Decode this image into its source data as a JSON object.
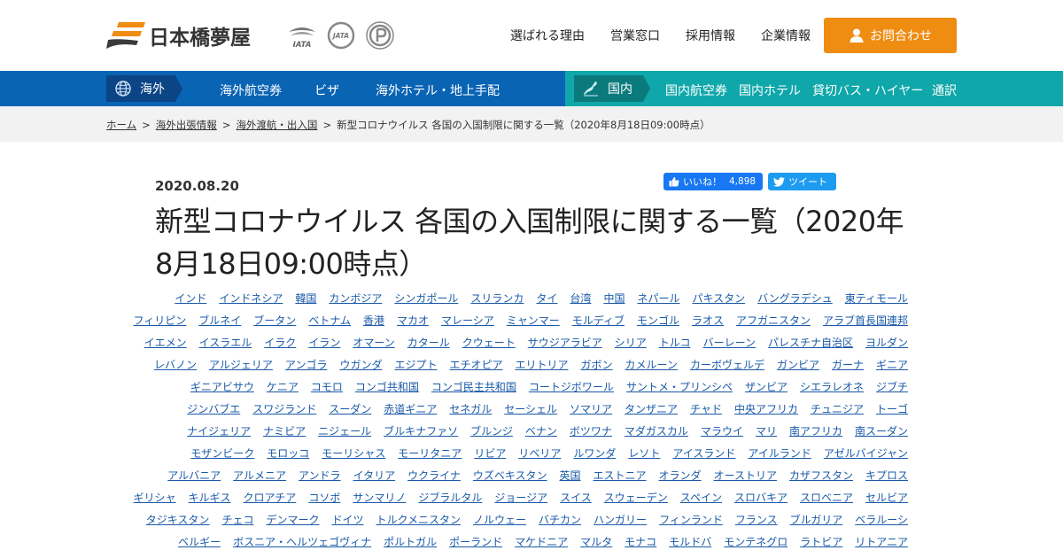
{
  "header": {
    "logo_text": "日本橋夢屋",
    "cert_labels": [
      "IATA",
      "JATA"
    ],
    "nav": [
      "選ばれる理由",
      "営業窓口",
      "採用情報",
      "企業情報"
    ],
    "contact_label": "お問合わせ",
    "colors": {
      "accent": "#ef8c12"
    }
  },
  "navbar": {
    "international": {
      "tag": "海外",
      "links": [
        "海外航空券",
        "ビザ",
        "海外ホテル・地上手配"
      ]
    },
    "domestic": {
      "tag": "国内",
      "links": [
        "国内航空券",
        "国内ホテル",
        "貸切バス・ハイヤー",
        "通訳"
      ]
    },
    "colors": {
      "international": "#0a64b4",
      "domestic": "#10a7aa"
    }
  },
  "breadcrumb": {
    "items": [
      "ホーム",
      "海外出張情報",
      "海外渡航・出入国"
    ],
    "current": "新型コロナウイルス 各国の入国制限に関する一覧（2020年8月18日09:00時点）",
    "separator": ">"
  },
  "article": {
    "date": "2020.08.20",
    "title": "新型コロナウイルス 各国の入国制限に関する一覧（2020年8月18日09:00時点）",
    "like_label": "いいね！",
    "like_count": "4,898",
    "tweet_label": "ツイート"
  },
  "countries": [
    [
      "インド",
      "インドネシア",
      "韓国",
      "カンボジア",
      "シンガポール",
      "スリランカ",
      "タイ",
      "台湾",
      "中国",
      "ネパール",
      "パキスタン",
      "バングラデシュ",
      "東ティモール"
    ],
    [
      "フィリピン",
      "ブルネイ",
      "ブータン",
      "ベトナム",
      "香港",
      "マカオ",
      "マレーシア",
      "ミャンマー",
      "モルディブ",
      "モンゴル",
      "ラオス",
      "アフガニスタン",
      "アラブ首長国連邦"
    ],
    [
      "イエメン",
      "イスラエル",
      "イラク",
      "イラン",
      "オマーン",
      "カタール",
      "クウェート",
      "サウジアラビア",
      "シリア",
      "トルコ",
      "バーレーン",
      "パレスチナ自治区",
      "ヨルダン"
    ],
    [
      "レバノン",
      "アルジェリア",
      "アンゴラ",
      "ウガンダ",
      "エジプト",
      "エチオピア",
      "エリトリア",
      "ガボン",
      "カメルーン",
      "カーボヴェルデ",
      "ガンビア",
      "ガーナ",
      "ギニア"
    ],
    [
      "ギニアビサウ",
      "ケニア",
      "コモロ",
      "コンゴ共和国",
      "コンゴ民主共和国",
      "コートジボワール",
      "サントメ・プリンシペ",
      "ザンビア",
      "シエラレオネ",
      "ジブチ"
    ],
    [
      "ジンバブエ",
      "スワジランド",
      "スーダン",
      "赤道ギニア",
      "セネガル",
      "セーシェル",
      "ソマリア",
      "タンザニア",
      "チャド",
      "中央アフリカ",
      "チュニジア",
      "トーゴ"
    ],
    [
      "ナイジェリア",
      "ナミビア",
      "ニジェール",
      "ブルキナファソ",
      "ブルンジ",
      "ベナン",
      "ボツワナ",
      "マダガスカル",
      "マラウイ",
      "マリ",
      "南アフリカ",
      "南スーダン"
    ],
    [
      "モザンビーク",
      "モロッコ",
      "モーリシャス",
      "モーリタニア",
      "リビア",
      "リベリア",
      "ルワンダ",
      "レソト",
      "アイスランド",
      "アイルランド",
      "アゼルバイジャン"
    ],
    [
      "アルバニア",
      "アルメニア",
      "アンドラ",
      "イタリア",
      "ウクライナ",
      "ウズベキスタン",
      "英国",
      "エストニア",
      "オランダ",
      "オーストリア",
      "カザフスタン",
      "キプロス"
    ],
    [
      "ギリシャ",
      "キルギス",
      "クロアチア",
      "コソボ",
      "サンマリノ",
      "ジブラルタル",
      "ジョージア",
      "スイス",
      "スウェーデン",
      "スペイン",
      "スロバキア",
      "スロベニア",
      "セルビア"
    ],
    [
      "タジキスタン",
      "チェコ",
      "デンマーク",
      "ドイツ",
      "トルクメニスタン",
      "ノルウェー",
      "バチカン",
      "ハンガリー",
      "フィンランド",
      "フランス",
      "ブルガリア",
      "ベラルーシ"
    ],
    [
      "ベルギー",
      "ボスニア・ヘルツェゴヴィナ",
      "ポルトガル",
      "ポーランド",
      "マケドニア",
      "マルタ",
      "モナコ",
      "モルドバ",
      "モンテネグロ",
      "ラトビア",
      "リトアニア"
    ]
  ]
}
